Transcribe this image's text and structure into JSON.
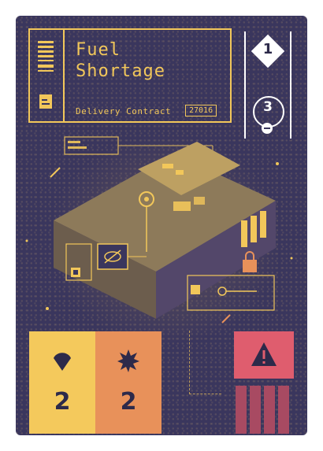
{
  "card": {
    "title_line1": "Fuel",
    "title_line2": "Shortage",
    "subtitle": "Delivery Contract",
    "code": "27016",
    "cost": "1",
    "resource": "3"
  },
  "stats": [
    {
      "icon": "teardrop-icon",
      "value": "2",
      "color": "#f4c95c"
    },
    {
      "icon": "burst-icon",
      "value": "2",
      "color": "#e8915a"
    }
  ],
  "hazard": {
    "icon": "warning-icon",
    "color": "#df5d6e"
  },
  "colors": {
    "background": "#3a365d",
    "accent": "#f2c75a",
    "white": "#ffffff"
  }
}
